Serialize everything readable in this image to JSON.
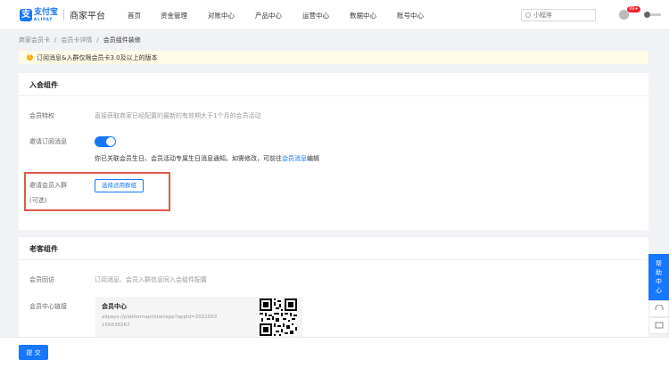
{
  "brand": {
    "mark": "支",
    "name": "支付宝",
    "sub": "ALIPAY",
    "platform": "商家平台"
  },
  "nav": {
    "items": [
      "首页",
      "资金管理",
      "对账中心",
      "产品中心",
      "运营中心",
      "数据中心",
      "账号中心"
    ]
  },
  "search": {
    "placeholder": "小程序"
  },
  "notifications": {
    "badge": "99+"
  },
  "breadcrumb": {
    "items": [
      "商家会员卡",
      "会员卡详情"
    ],
    "current": "会员组件装修",
    "separator": "/"
  },
  "notice": {
    "text": "订阅消息&入群仅限会员卡3.0及以上的版本",
    "icon": "!"
  },
  "join_section": {
    "title": "入会组件",
    "privilege_label": "会员特权",
    "privilege_desc": "直接获取商家已经配置的最新的有效期大于1个月的会员活动",
    "subscribe_label": "邀请订阅消息",
    "subscribe_on": true,
    "subscribe_note": "你已关联会员生日、会员活动专属生日消息通知。如需修改，可前往",
    "subscribe_link": "会员消息",
    "subscribe_note_tail": "编辑",
    "group_label": "邀请会员入群",
    "group_optional": "(可选)",
    "group_button": "选择适用群组"
  },
  "returning_section": {
    "title": "老客组件",
    "revisit_label": "会员回访",
    "revisit_desc": "订阅消息、会员入群信息同入会组件配置",
    "link_label": "会员中心链接",
    "link_title": "会员中心",
    "link_url": "alipays://platformapi/startapp?appId=2021003156638267"
  },
  "help": {
    "label": "帮助中心",
    "tools": [
      "headset-icon",
      "feedback-icon"
    ]
  },
  "footer": {
    "submit_label": "提 交"
  },
  "colors": {
    "accent": "#1677ff",
    "highlight_border": "#e0584a",
    "notice_bg": "#fffbe6",
    "badge": "#f5222d"
  }
}
